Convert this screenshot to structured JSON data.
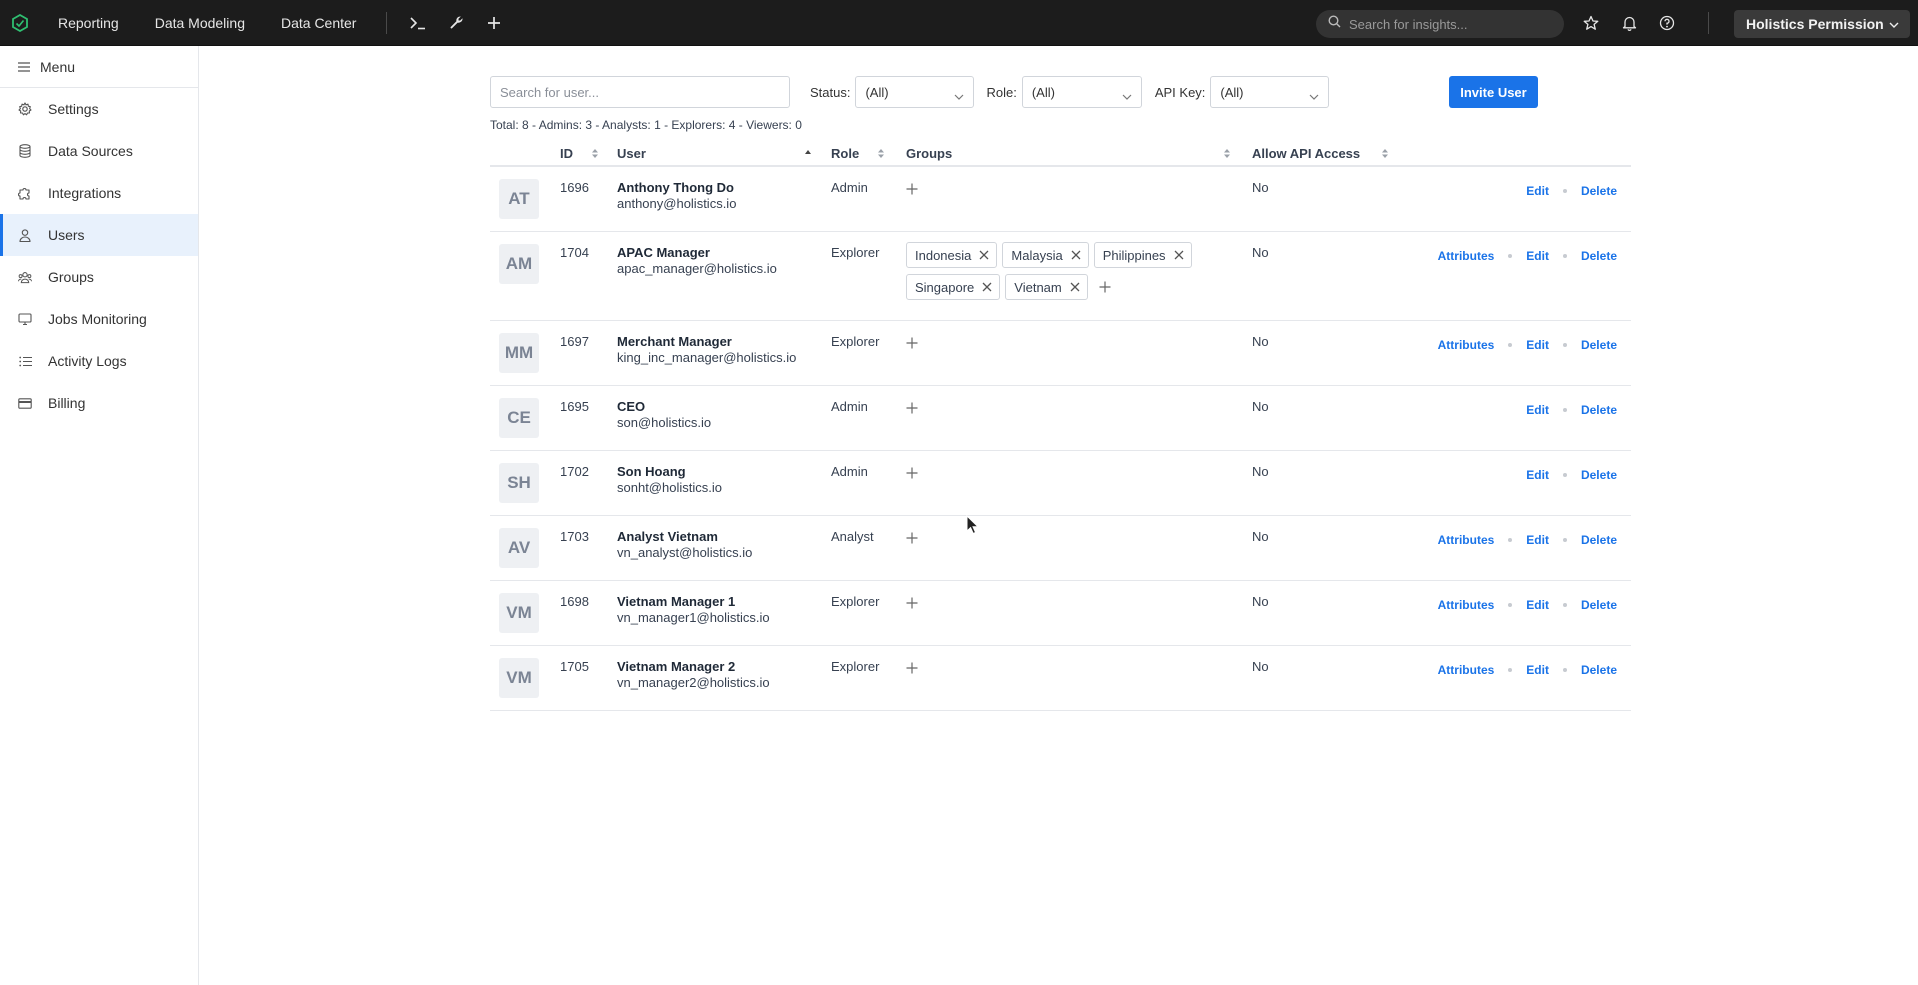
{
  "topbar": {
    "nav": [
      "Reporting",
      "Data Modeling",
      "Data Center"
    ],
    "icons": [
      "terminal-icon",
      "wrench-icon",
      "plus-icon"
    ],
    "search_placeholder": "Search for insights...",
    "right_icons": [
      "star-icon",
      "bell-icon",
      "help-icon"
    ],
    "workspace": "Holistics Permission"
  },
  "sidebar": {
    "menu_label": "Menu",
    "items": [
      {
        "label": "Settings",
        "icon": "gear-icon"
      },
      {
        "label": "Data Sources",
        "icon": "database-icon"
      },
      {
        "label": "Integrations",
        "icon": "puzzle-icon"
      },
      {
        "label": "Users",
        "icon": "user-icon",
        "active": true
      },
      {
        "label": "Groups",
        "icon": "group-icon"
      },
      {
        "label": "Jobs Monitoring",
        "icon": "monitor-icon"
      },
      {
        "label": "Activity Logs",
        "icon": "list-icon"
      },
      {
        "label": "Billing",
        "icon": "credit-card-icon"
      }
    ]
  },
  "filters": {
    "search_placeholder": "Search for user...",
    "status_label": "Status:",
    "status_value": "(All)",
    "role_label": "Role:",
    "role_value": "(All)",
    "api_label": "API Key:",
    "api_value": "(All)",
    "invite_label": "Invite User"
  },
  "summary": "Total: 8 - Admins: 3 - Analysts: 1 - Explorers: 4 - Viewers: 0",
  "table": {
    "headers": {
      "id": "ID",
      "user": "User",
      "role": "Role",
      "groups": "Groups",
      "api": "Allow API Access"
    },
    "rows": [
      {
        "initials": "AT",
        "id": "1696",
        "name": "Anthony Thong Do",
        "email": "anthony@holistics.io",
        "role": "Admin",
        "groups": [],
        "api": "No",
        "actions": [
          "Edit",
          "Delete"
        ]
      },
      {
        "initials": "AM",
        "id": "1704",
        "name": "APAC Manager",
        "email": "apac_manager@holistics.io",
        "role": "Explorer",
        "groups": [
          "Indonesia",
          "Malaysia",
          "Philippines",
          "Singapore",
          "Vietnam"
        ],
        "api": "No",
        "actions": [
          "Attributes",
          "Edit",
          "Delete"
        ]
      },
      {
        "initials": "MM",
        "id": "1697",
        "name": "Merchant Manager",
        "email": "king_inc_manager@holistics.io",
        "role": "Explorer",
        "groups": [],
        "api": "No",
        "actions": [
          "Attributes",
          "Edit",
          "Delete"
        ]
      },
      {
        "initials": "CE",
        "id": "1695",
        "name": "CEO",
        "email": "son@holistics.io",
        "role": "Admin",
        "groups": [],
        "api": "No",
        "actions": [
          "Edit",
          "Delete"
        ]
      },
      {
        "initials": "SH",
        "id": "1702",
        "name": "Son Hoang",
        "email": "sonht@holistics.io",
        "role": "Admin",
        "groups": [],
        "api": "No",
        "actions": [
          "Edit",
          "Delete"
        ]
      },
      {
        "initials": "AV",
        "id": "1703",
        "name": "Analyst Vietnam",
        "email": "vn_analyst@holistics.io",
        "role": "Analyst",
        "groups": [],
        "api": "No",
        "actions": [
          "Attributes",
          "Edit",
          "Delete"
        ]
      },
      {
        "initials": "VM",
        "id": "1698",
        "name": "Vietnam Manager 1",
        "email": "vn_manager1@holistics.io",
        "role": "Explorer",
        "groups": [],
        "api": "No",
        "actions": [
          "Attributes",
          "Edit",
          "Delete"
        ]
      },
      {
        "initials": "VM",
        "id": "1705",
        "name": "Vietnam Manager 2",
        "email": "vn_manager2@holistics.io",
        "role": "Explorer",
        "groups": [],
        "api": "No",
        "actions": [
          "Attributes",
          "Edit",
          "Delete"
        ]
      }
    ]
  },
  "colors": {
    "accent": "#1a73e8",
    "topbar": "#1c1c1c",
    "active_bg": "#e8f1fc"
  }
}
